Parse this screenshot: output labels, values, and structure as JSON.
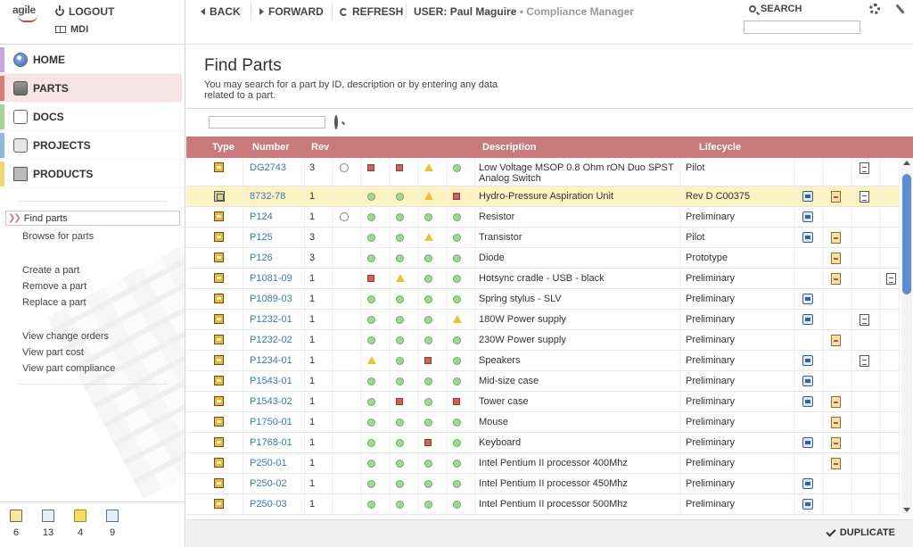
{
  "brand": {
    "logo_text": "agile"
  },
  "session": {
    "logout_label": "LOGOUT",
    "mdi_label": "MDI"
  },
  "nav": [
    {
      "label": "HOME",
      "icon": "globe-icon",
      "color": "#c9a7dc"
    },
    {
      "label": "PARTS",
      "icon": "parts-icon",
      "color": "#d97b7b"
    },
    {
      "label": "DOCS",
      "icon": "document-icon",
      "color": "#a8d29a"
    },
    {
      "label": "PROJECTS",
      "icon": "projects-icon",
      "color": "#93b6df"
    },
    {
      "label": "PRODUCTS",
      "icon": "products-icon",
      "color": "#f1d770"
    }
  ],
  "links": {
    "find": "Find parts",
    "browse": "Browse for parts",
    "create": "Create a part",
    "remove": "Remove a part",
    "replace": "Replace a part",
    "change_orders": "View change orders",
    "cost": "View part cost",
    "compliance": "View part compliance"
  },
  "tray": [
    {
      "icon": "clipboard-icon",
      "count": "6"
    },
    {
      "icon": "mail-icon",
      "count": "13"
    },
    {
      "icon": "folder-icon",
      "count": "4"
    },
    {
      "icon": "person-icon",
      "count": "9"
    }
  ],
  "toolbar": {
    "back": "BACK",
    "forward": "FORWARD",
    "refresh": "REFRESH",
    "user_prefix": "USER:",
    "user_name": "Paul Maguire",
    "user_role": "• Compliance Manager",
    "search_label": "SEARCH",
    "search_value": ""
  },
  "page": {
    "title": "Find Parts",
    "description": "You may search for a part by ID, description or by entering any data related to a part.",
    "find_value": ""
  },
  "table": {
    "headers": {
      "type": "Type",
      "number": "Number",
      "rev": "Rev",
      "description": "Description",
      "lifecycle": "Lifecycle"
    },
    "rows": [
      {
        "type": "part",
        "number": "DG2743",
        "rev": "3",
        "attach": true,
        "s": [
          "sq",
          "sq",
          "tri",
          "dot"
        ],
        "desc": "Low Voltage MSOP 0.8 Ohm rON Duo SPST Analog Switch",
        "life": "Pilot",
        "a": [
          false,
          false,
          true,
          false
        ],
        "tall": true
      },
      {
        "type": "assembly",
        "number": "8732-78",
        "rev": "1",
        "attach": false,
        "s": [
          "dot",
          "dot",
          "tri",
          "sq"
        ],
        "desc": "Hydro-Pressure Aspiration Unit",
        "life": "Rev D C00375",
        "a": [
          true,
          true,
          true,
          false
        ],
        "highlight": true
      },
      {
        "type": "part",
        "number": "P124",
        "rev": "1",
        "attach": true,
        "s": [
          "dot",
          "dot",
          "dot",
          "dot"
        ],
        "desc": "Resistor",
        "life": "Preliminary",
        "a": [
          true,
          false,
          false,
          false
        ]
      },
      {
        "type": "part",
        "number": "P125",
        "rev": "3",
        "attach": false,
        "s": [
          "dot",
          "dot",
          "tri",
          "dot"
        ],
        "desc": "Transistor",
        "life": "Pilot",
        "a": [
          true,
          true,
          false,
          false
        ]
      },
      {
        "type": "part",
        "number": "P126",
        "rev": "3",
        "attach": false,
        "s": [
          "dot",
          "dot",
          "dot",
          "dot"
        ],
        "desc": "Diode",
        "life": "Prototype",
        "a": [
          false,
          true,
          false,
          false
        ]
      },
      {
        "type": "part",
        "number": "P1081-09",
        "rev": "1",
        "attach": false,
        "s": [
          "sq",
          "tri",
          "dot",
          "dot"
        ],
        "desc": "Hotsync cradle - USB - black",
        "life": "Preliminary",
        "a": [
          false,
          true,
          false,
          true
        ]
      },
      {
        "type": "part",
        "number": "P1089-03",
        "rev": "1",
        "attach": false,
        "s": [
          "dot",
          "dot",
          "dot",
          "dot"
        ],
        "desc": "Spring stylus - SLV",
        "life": "Preliminary",
        "a": [
          true,
          false,
          false,
          false
        ]
      },
      {
        "type": "part",
        "number": "P1232-01",
        "rev": "1",
        "attach": false,
        "s": [
          "dot",
          "dot",
          "dot",
          "tri"
        ],
        "desc": "180W Power supply",
        "life": "Preliminary",
        "a": [
          true,
          false,
          true,
          false
        ]
      },
      {
        "type": "part",
        "number": "P1232-02",
        "rev": "1",
        "attach": false,
        "s": [
          "dot",
          "dot",
          "dot",
          "dot"
        ],
        "desc": "230W Power supply",
        "life": "Preliminary",
        "a": [
          false,
          true,
          false,
          false
        ]
      },
      {
        "type": "part",
        "number": "P1234-01",
        "rev": "1",
        "attach": false,
        "s": [
          "tri",
          "dot",
          "sq",
          "dot"
        ],
        "desc": "Speakers",
        "life": "Preliminary",
        "a": [
          true,
          false,
          true,
          false
        ]
      },
      {
        "type": "part",
        "number": "P1543-01",
        "rev": "1",
        "attach": false,
        "s": [
          "dot",
          "dot",
          "dot",
          "dot"
        ],
        "desc": "Mid-size case",
        "life": "Preliminary",
        "a": [
          true,
          false,
          false,
          false
        ]
      },
      {
        "type": "part",
        "number": "P1543-02",
        "rev": "1",
        "attach": false,
        "s": [
          "dot",
          "sq",
          "dot",
          "sq"
        ],
        "desc": "Tower case",
        "life": "Preliminary",
        "a": [
          true,
          true,
          false,
          false
        ]
      },
      {
        "type": "part",
        "number": "P1750-01",
        "rev": "1",
        "attach": false,
        "s": [
          "dot",
          "dot",
          "dot",
          "dot"
        ],
        "desc": "Mouse",
        "life": "Preliminary",
        "a": [
          false,
          true,
          false,
          false
        ]
      },
      {
        "type": "part",
        "number": "P1768-01",
        "rev": "1",
        "attach": false,
        "s": [
          "dot",
          "dot",
          "sq",
          "dot"
        ],
        "desc": "Keyboard",
        "life": "Preliminary",
        "a": [
          true,
          true,
          false,
          false
        ]
      },
      {
        "type": "part",
        "number": "P250-01",
        "rev": "1",
        "attach": false,
        "s": [
          "dot",
          "dot",
          "dot",
          "dot"
        ],
        "desc": "Intel Pentium II processor 400Mhz",
        "life": "Preliminary",
        "a": [
          false,
          true,
          false,
          false
        ]
      },
      {
        "type": "part",
        "number": "P250-02",
        "rev": "1",
        "attach": false,
        "s": [
          "dot",
          "dot",
          "dot",
          "dot"
        ],
        "desc": "Intel Pentium II processor 450Mhz",
        "life": "Preliminary",
        "a": [
          true,
          false,
          false,
          false
        ]
      },
      {
        "type": "part",
        "number": "P250-03",
        "rev": "1",
        "attach": false,
        "s": [
          "dot",
          "dot",
          "dot",
          "dot"
        ],
        "desc": "Intel Pentium II processor 500Mhz",
        "life": "Preliminary",
        "a": [
          true,
          false,
          false,
          false
        ]
      }
    ]
  },
  "footer": {
    "duplicate": "DUPLICATE"
  },
  "colors": {
    "header": "#c97979",
    "highlight": "#fcf2c2",
    "link": "#3b78b8",
    "active_nav": "#f7e4e4"
  }
}
